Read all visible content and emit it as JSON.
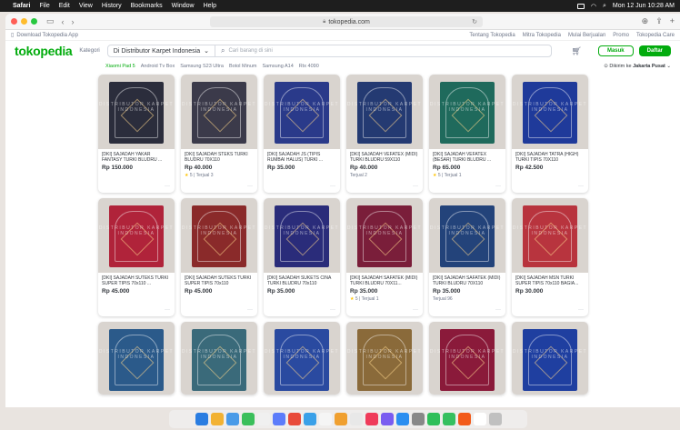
{
  "menubar": {
    "app": "Safari",
    "items": [
      "File",
      "Edit",
      "View",
      "History",
      "Bookmarks",
      "Window",
      "Help"
    ],
    "clock": "Mon 12 Jun 10:28 AM"
  },
  "browser": {
    "url": "tokopedia.com"
  },
  "topstrip": {
    "download": "Download Tokopedia App",
    "links": [
      "Tentang Tokopedia",
      "Mitra Tokopedia",
      "Mulai Berjualan",
      "Promo",
      "Tokopedia Care"
    ]
  },
  "header": {
    "logo": "tokopedia",
    "kategori": "Kategori",
    "search_scope": "Di Distributor Karpet Indonesia",
    "search_placeholder": "Cari barang di sini",
    "masuk": "Masuk",
    "daftar": "Daftar"
  },
  "suggestions": [
    "Xiaomi Pad 5",
    "Android Tv Box",
    "Samsung S23 Ultra",
    "Botol Minum",
    "Samsung A14",
    "Rtx 4090"
  ],
  "delivery": {
    "prefix": "Dikirim ke",
    "location": "Jakarta Pusat"
  },
  "watermark": "DISTRIBUTOR KARPET INDONESIA",
  "products": [
    {
      "name": "[DKI] SAJADAH YAKAR FANTASY TURKI BLUDRU ...",
      "price": "Rp 150.000",
      "meta": "",
      "color": "#2b2d3c"
    },
    {
      "name": "[DKI] SAJADAH STEKS TURKI BLUDRU 70X110",
      "price": "Rp 40.000",
      "meta": "5 | Terjual 3",
      "color": "#3b3a4a"
    },
    {
      "name": "[DKI] SAJADAH JS (TIPIS RUMBAI HALUS) TURKI ...",
      "price": "Rp 35.000",
      "meta": "",
      "color": "#2a3a8a"
    },
    {
      "name": "[DKI] SAJADAH VEFATEX (MIDI) TURKI BLUDRU 59X110",
      "price": "Rp 40.000",
      "meta": "Terjual 2",
      "color": "#243a72"
    },
    {
      "name": "[DKI] SAJADAH VEFATEX (BESAR) TURKI BLUDRU ...",
      "price": "Rp 65.000",
      "meta": "5 | Terjual 1",
      "color": "#1f6a5c"
    },
    {
      "name": "[DKI] SAJADAH TATRA (HIGH) TURKI TIPIS 70X110",
      "price": "Rp 42.500",
      "meta": "",
      "color": "#1f3a9a"
    },
    {
      "name": "[DKI] SAJADAH SUTEKS TURKI SUPER TIPIS 70x110 ...",
      "price": "Rp 45.000",
      "meta": "",
      "color": "#b0233a"
    },
    {
      "name": "[DKI] SAJADAH SUTEKS TURKI SUPER TIPIS 70x110",
      "price": "Rp 45.000",
      "meta": "",
      "color": "#8a2a2a"
    },
    {
      "name": "[DKI] SAJADAH SUKETS CINA TURKI BLUDRU 70x110",
      "price": "Rp 35.000",
      "meta": "",
      "color": "#2a2c7a"
    },
    {
      "name": "[DKI] SAJADAH SAFATEK (MIDI) TURKI BLUDRU 70X11...",
      "price": "Rp 35.000",
      "meta": "5 | Terjual 1",
      "color": "#7a1e3a"
    },
    {
      "name": "[DKI] SAJADAH SAFATEK (MIDI) TURKI BLUDRU 70X110",
      "price": "Rp 35.000",
      "meta": "Terjual 96",
      "color": "#23437a"
    },
    {
      "name": "[DKI] SAJADAH MSN TURKI SUPER TIPIS 70x110 BAGIA...",
      "price": "Rp 30.000",
      "meta": "",
      "color": "#b8343e"
    },
    {
      "name": "",
      "price": "",
      "meta": "",
      "color": "#2b5a8a"
    },
    {
      "name": "",
      "price": "",
      "meta": "",
      "color": "#3a6a7a"
    },
    {
      "name": "",
      "price": "",
      "meta": "",
      "color": "#2a4aa0"
    },
    {
      "name": "",
      "price": "",
      "meta": "",
      "color": "#8a6a3a"
    },
    {
      "name": "",
      "price": "",
      "meta": "",
      "color": "#8a1a3a"
    },
    {
      "name": "",
      "price": "",
      "meta": "",
      "color": "#1f3fa0"
    }
  ],
  "colors": {
    "brand": "#03ac0e",
    "star": "#ffc400"
  }
}
